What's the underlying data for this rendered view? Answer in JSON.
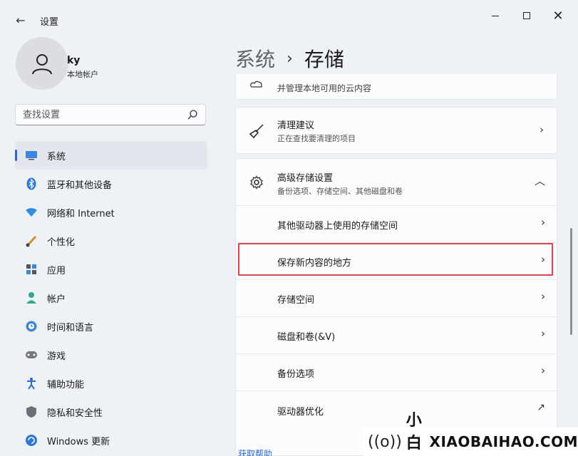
{
  "window": {
    "title": "设置",
    "back_icon": "←",
    "close_icon": "✕"
  },
  "profile": {
    "name": "ky",
    "account_type": "本地帐户"
  },
  "search": {
    "placeholder": "查找设置"
  },
  "sidebar": {
    "items": [
      {
        "label": "系统",
        "icon": "monitor-icon",
        "active": true
      },
      {
        "label": "蓝牙和其他设备",
        "icon": "bluetooth-icon"
      },
      {
        "label": "网络和 Internet",
        "icon": "wifi-icon"
      },
      {
        "label": "个性化",
        "icon": "brush-icon"
      },
      {
        "label": "应用",
        "icon": "apps-icon"
      },
      {
        "label": "帐户",
        "icon": "person-icon"
      },
      {
        "label": "时间和语言",
        "icon": "globe-clock-icon"
      },
      {
        "label": "游戏",
        "icon": "gamepad-icon"
      },
      {
        "label": "辅助功能",
        "icon": "accessibility-icon"
      },
      {
        "label": "隐私和安全性",
        "icon": "shield-icon"
      },
      {
        "label": "Windows 更新",
        "icon": "update-icon"
      }
    ]
  },
  "header": {
    "parent": "系统",
    "separator": "›",
    "current": "存储"
  },
  "content": {
    "cloud_sub": "并管理本地可用的云内容",
    "cleanup": {
      "title": "清理建议",
      "subtitle": "正在查找要清理的项目"
    },
    "advanced": {
      "title": "高级存储设置",
      "subtitle": "备份选项、存储空间、其他磁盘和卷"
    },
    "sub_items": [
      {
        "label": "其他驱动器上使用的存储空间",
        "chevron": "›"
      },
      {
        "label": "保存新内容的地方",
        "chevron": "›",
        "highlighted": true
      },
      {
        "label": "存储空间",
        "chevron": "›"
      },
      {
        "label": "磁盘和卷(&V)",
        "chevron": "›"
      },
      {
        "label": "备份选项",
        "chevron": "›"
      },
      {
        "label": "驱动器优化",
        "chevron": "↗"
      }
    ],
    "chevron": "›",
    "collapse": "︿",
    "get_help": "获取帮助"
  },
  "watermark": {
    "icon": "((o))",
    "text_cn": "小白号",
    "text_url": "XIAOBAIHAO.COM"
  },
  "colors": {
    "accent": "#2a67d1",
    "highlight_border": "#d9454b",
    "background": "#eef1f6",
    "card": "#fbfcfd"
  }
}
